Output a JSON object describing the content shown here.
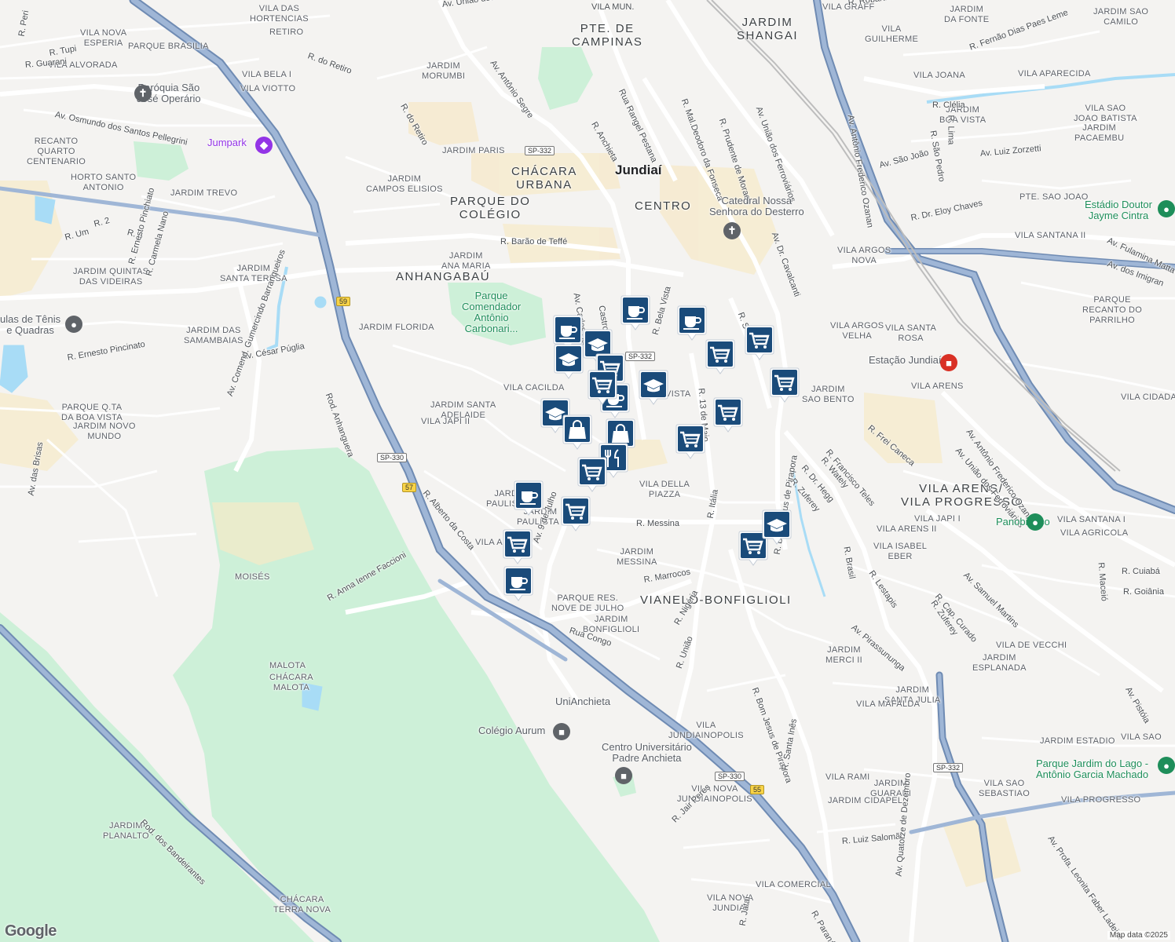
{
  "attribution": "Map data ©2025",
  "logo": "Google",
  "colors": {
    "highway": "#8aa4c8",
    "highway_edge": "#6e8ab3",
    "road": "#ffffff",
    "green": "#c9f0d6",
    "water": "#9dd6f5",
    "marker": "#1a4b7a"
  },
  "districts": [
    {
      "text": "PTE. DE\nCAMPINAS",
      "cls": "big"
    },
    {
      "text": "JARDIM\nSHANGAI",
      "cls": "big"
    },
    {
      "text": "CHÁCARA\nURBANA",
      "cls": "big"
    },
    {
      "text": "Jundiaí",
      "cls": "city"
    },
    {
      "text": "PARQUE DO\nCOLÉGIO",
      "cls": "big"
    },
    {
      "text": "CENTRO",
      "cls": "big"
    },
    {
      "text": "ANHANGABAÚ",
      "cls": "big"
    },
    {
      "text": "VIANELO-BONFIGLIOLI",
      "cls": "big"
    },
    {
      "text": "VILA ARENS/\nVILA PROGRESSO",
      "cls": "big"
    }
  ],
  "neighborhoods": [
    "VILA DAS\nHORTENCIAS",
    "VILA NOVA\nESPERIA",
    "PARQUE BRASILIA",
    "RETIRO",
    "VILA ALVORADA",
    "VILA BELA I",
    "VILA VIOTTO",
    "JARDIM\nMORUMBI",
    "JARDIM PARIS",
    "RECANTO\nQUARTO\nCENTENARIO",
    "HORTO SANTO\nANTONIO",
    "JARDIM TREVO",
    "JARDIM\nCAMPOS ELISIOS",
    "JARDIM QUINTAS\nDAS VIDEIRAS",
    "JARDIM\nSANTA TERESA",
    "JARDIM\nANA MARIA",
    "JARDIM DAS\nSAMAMBAIAS",
    "JARDIM FLORIDA",
    "PARQUE Q.TA\nDA BOA VISTA",
    "JARDIM NOVO\nMUNDO",
    "JARDIM SANTA\nADELAIDE",
    "VILA JAPI II",
    "VILA CACILDA",
    "MOISÉS",
    "JARDIM\nPAULISTA II",
    "JARDIM\nPAULISTA I",
    "VILA A",
    "VILA DELLA\nPIAZZA",
    "JARDIM\nMESSINA",
    "PARQUE RES.\nNOVE DE JULHO",
    "JARDIM\nBONFIGLIOLI",
    "MALOTA",
    "CHÁCARA\nMALOTA",
    "JARDIM\nPLANALTO",
    "CHÁCARA\nTERRA NOVA",
    "VILA\nJUNDIAINOPOLIS",
    "VILA NOVA\nJUNDIAINOPOLIS",
    "VILA NOVA\nJUNDIAI",
    "VILA COMERCIAL",
    "VILA GRAFF",
    "JARDIM\nDA FONTE",
    "VILA\nGUILHERME",
    "JARDIM SAO\nCAMILO",
    "VILA JOANA",
    "VILA APARECIDA",
    "JARDIM\nBOA VISTA",
    "VILA SAO\nJOAO BATISTA",
    "JARDIM\nPACAEMBU",
    "PTE. SAO JOAO",
    "VILA SANTANA II",
    "PARQUE\nRECANTO DO\nPARRILHO",
    "VILA ARGOS\nNOVA",
    "VILA ARGOS\nVELHA",
    "VILA SANTA\nROSA",
    "VILA ARENS",
    "JARDIM\nSAO BENTO",
    "VILA CIDADA",
    "VILA JAPI I",
    "VILA ARENS II",
    "VILA ISABEL\nEBER",
    "VILA SANTANA I",
    "VILA AGRICOLA",
    "VILA DE VECCHI",
    "JARDIM\nESPLANADA",
    "JARDIM\nMERCI II",
    "JARDIM\nSANTA JULIA",
    "VILA MAFALDA",
    "JARDIM ESTADIO",
    "VILA SAO",
    "VILA RAMI",
    "JARDIM\nGUARANI",
    "JARDIM CIDAPEL",
    "VILA SAO\nSEBASTIAO",
    "VILA PROGRESSO",
    "BELA VISTA"
  ],
  "streets": [
    "Av. União dos Ferroviários",
    "VILA MUN.",
    "R. Robartino Marto",
    "R. Peri",
    "R. Tupi",
    "R. Guarani",
    "R. do Retiro",
    "Av. Antônio Segre",
    "Rua Rangel Pestana",
    "R. Mal.Deodoro da Fonseca",
    "R. Prudente de Moraes",
    "Av. União dos Ferroviários",
    "Av. Osmundo dos Santos Pellegrini",
    "R. do Retiro",
    "R. Anchieta",
    "R. Um",
    "R. 2",
    "R. 6",
    "R. Ernesto Pinchiato",
    "R. Carmela Nano",
    "R. Barão de Teffé",
    "Av. Carlos Salles",
    "Castro",
    "R. Bela Vista",
    "R. S",
    "Av. Dr. Cavalcanti",
    "Av. Antônio Frederico Ozanan",
    "R. Clélia",
    "R. São Pedro",
    "R. Lima",
    "Av. São João",
    "Av. Luiz Zorzetti",
    "R. Dr. Eloy Chaves",
    "Av. Fulamina Matta",
    "Av. dos Imigran",
    "R. Fernão Dias Paes Leme",
    "R. Ernesto Pincinato",
    "Av. César Púglia",
    "Av. Comend. Gumercindo Barranqueiros",
    "Rod. Anhanguera",
    "Av. das Brisas",
    "R. Alberto da Costa",
    "R. Anna Ienne Faccioni",
    "Av. 9 de Julho",
    "R. Messina",
    "R. Marrocos",
    "Rua Congo",
    "R. Nigéria",
    "R. União",
    "R. Itália",
    "R. Bom Jesus de Pirapora",
    "R. 13 de Maio",
    "R. Zuferey",
    "R. Dr. Hegg",
    "R. Wately",
    "R. Francisco Teles",
    "R. Frei Caneca",
    "Av. União dos Ferroviários",
    "Av. Antônio Frederico Ozanan",
    "R. Brasil",
    "R. Lestapis",
    "R. Zuferey",
    "R. Cap. Curado",
    "Av. Samuel Martins",
    "Av. Pirassununga",
    "R. Maceió",
    "R. Cuiabá",
    "R. Goiânia",
    "Av. Pistóia",
    "Rod. dos Bandeirantes",
    "R. Jair Peres",
    "R. Santa Inês",
    "R. Luiz Salomão",
    "Av. Quatorze de Dezembro",
    "R. Paraná",
    "R. Jataí",
    "Av. Profa. Leonita Faber Ladeira",
    "R. Bom Jesus de Pirapora"
  ],
  "pois": [
    {
      "name": "Paróquia São\nJosé Operário",
      "kind": "church"
    },
    {
      "name": "Jumpark",
      "kind": "purple"
    },
    {
      "name": "Catedral Nossa\nSenhora do Desterro",
      "kind": "church"
    },
    {
      "name": "Parque\nComendador\nAntônio\nCarbonari...",
      "kind": "green"
    },
    {
      "name": "ulas de Tênis\ne Quadras",
      "kind": "gray"
    },
    {
      "name": "Estádio Doutor\nJayme Cintra",
      "kind": "green"
    },
    {
      "name": "Estação Jundiaí",
      "kind": "rail"
    },
    {
      "name": "Panobianco",
      "kind": "green"
    },
    {
      "name": "UniAnchieta",
      "kind": "plain"
    },
    {
      "name": "Colégio Aurum",
      "kind": "school"
    },
    {
      "name": "Centro Universitário\nPadre Anchieta",
      "kind": "school"
    },
    {
      "name": "Parque Jardim do Lago -\nAntônio Garcia Machado",
      "kind": "green"
    }
  ],
  "shields": [
    "SP-332",
    "SP-332",
    "59",
    "SP-330",
    "57",
    "SP-330",
    "55",
    "SP-332"
  ],
  "markers": [
    {
      "type": "cafe"
    },
    {
      "type": "cafe"
    },
    {
      "type": "cafe"
    },
    {
      "type": "school"
    },
    {
      "type": "school"
    },
    {
      "type": "cart"
    },
    {
      "type": "cart"
    },
    {
      "type": "cart"
    },
    {
      "type": "cafe"
    },
    {
      "type": "school"
    },
    {
      "type": "school"
    },
    {
      "type": "cart"
    },
    {
      "type": "bag"
    },
    {
      "type": "bag"
    },
    {
      "type": "food"
    },
    {
      "type": "cart"
    },
    {
      "type": "cart"
    },
    {
      "type": "cart"
    },
    {
      "type": "cart"
    },
    {
      "type": "school"
    },
    {
      "type": "cafe"
    },
    {
      "type": "cart"
    },
    {
      "type": "cafe"
    },
    {
      "type": "cart"
    },
    {
      "type": "cart"
    }
  ]
}
